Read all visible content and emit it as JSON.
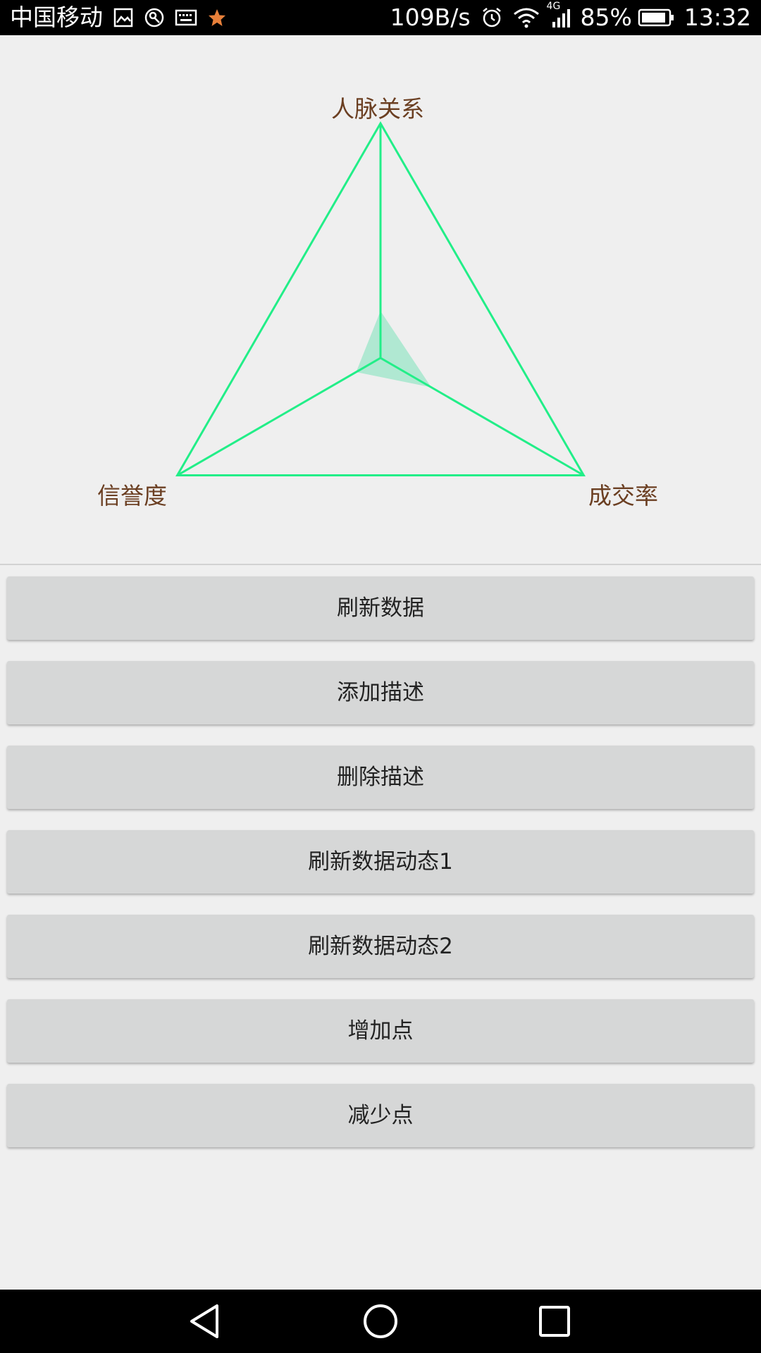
{
  "status_bar": {
    "carrier": "中国移动",
    "network_speed": "109B/s",
    "network_type": "4G",
    "battery_percent": "85%",
    "time": "13:32",
    "left_icons": [
      "gallery-icon",
      "vpn-icon",
      "keyboard-icon",
      "star-icon"
    ],
    "right_icons": [
      "alarm-icon",
      "wifi-icon",
      "signal-icon",
      "battery-icon"
    ]
  },
  "radar": {
    "axes": [
      {
        "label": "人脉关系",
        "value": 0.2
      },
      {
        "label": "成交率",
        "value": 0.25
      },
      {
        "label": "信誉度",
        "value": 0.12
      }
    ],
    "max": 1.0,
    "line_color": "#22ee88",
    "fill_color": "#9be5c8",
    "label_color": "#6b3f22"
  },
  "buttons": [
    {
      "label": "刷新数据"
    },
    {
      "label": "添加描述"
    },
    {
      "label": "删除描述"
    },
    {
      "label": "刷新数据动态1"
    },
    {
      "label": "刷新数据动态2"
    },
    {
      "label": "增加点"
    },
    {
      "label": "减少点"
    }
  ],
  "nav_bar": {
    "icons": [
      "back-icon",
      "home-icon",
      "recents-icon"
    ]
  }
}
